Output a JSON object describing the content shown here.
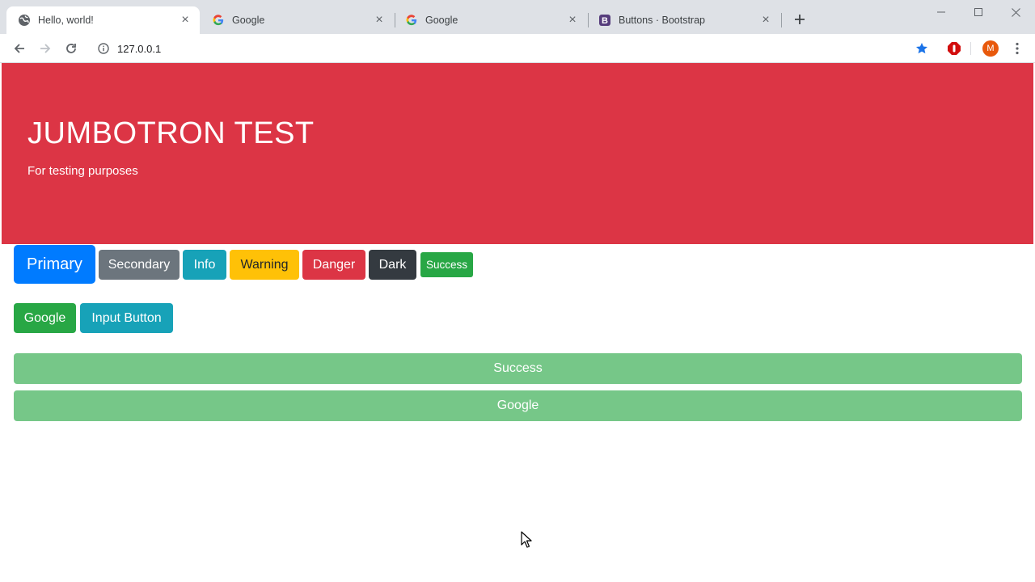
{
  "browser": {
    "tabs": [
      {
        "title": "Hello, world!",
        "favicon": "globe-icon"
      },
      {
        "title": "Google",
        "favicon": "google-icon"
      },
      {
        "title": "Google",
        "favicon": "google-icon"
      },
      {
        "title": "Buttons · Bootstrap",
        "favicon": "bootstrap-icon"
      }
    ],
    "url": "127.0.0.1",
    "avatar_letter": "M"
  },
  "jumbotron": {
    "title": "JUMBOTRON TEST",
    "lead": "For testing purposes",
    "color": "#dc3545"
  },
  "buttons_row1": {
    "primary": "Primary",
    "secondary": "Secondary",
    "info": "Info",
    "warning": "Warning",
    "danger": "Danger",
    "dark": "Dark",
    "success_small": "Success"
  },
  "buttons_row2": {
    "google": "Google",
    "input_button": "Input Button"
  },
  "block_buttons": {
    "success": "Success",
    "google": "Google"
  },
  "colors": {
    "primary": "#007bff",
    "secondary": "#6c757d",
    "info": "#17a2b8",
    "warning": "#ffc107",
    "danger": "#dc3545",
    "dark": "#343a40",
    "success": "#28a745"
  }
}
